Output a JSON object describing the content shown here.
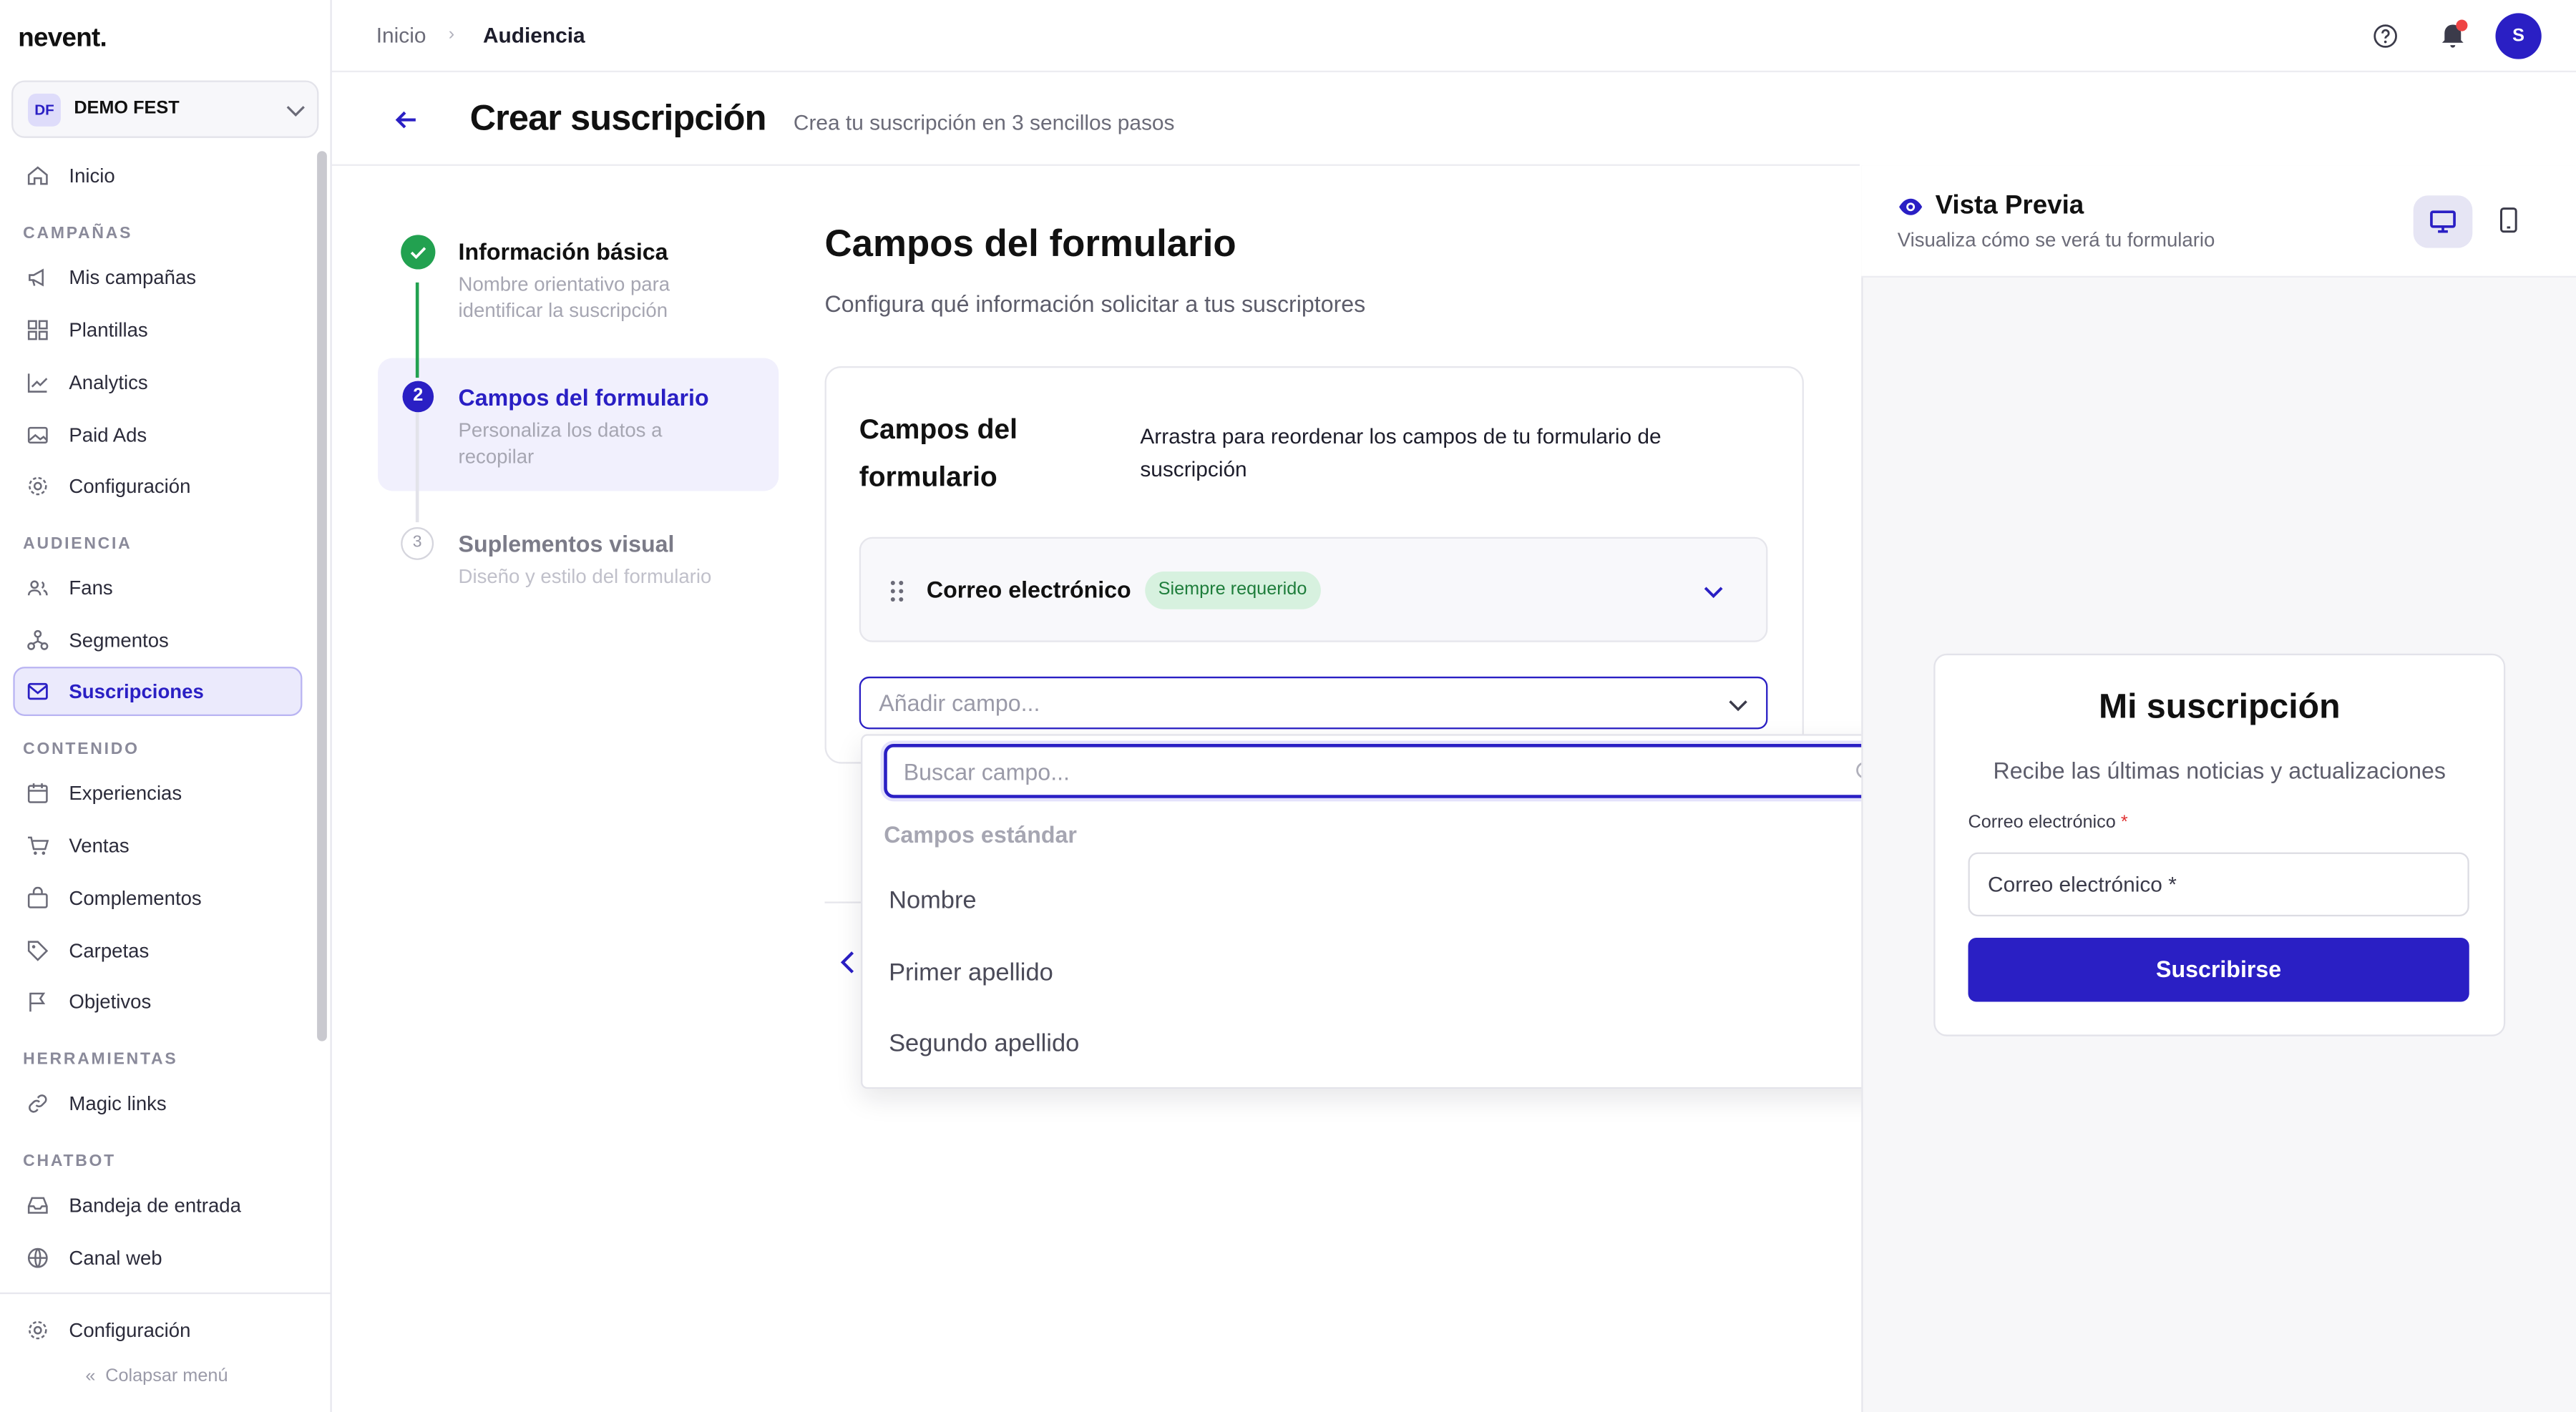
{
  "brand": {
    "logo": "nevent.",
    "org_initials": "DF",
    "org_name": "DEMO FEST",
    "accent": "#2a1fc4"
  },
  "sidebar": {
    "items": [
      {
        "label": "Inicio",
        "icon": "home-icon"
      },
      {
        "label": "Mis campañas",
        "icon": "megaphone-icon"
      },
      {
        "label": "Plantillas",
        "icon": "templates-icon"
      },
      {
        "label": "Analytics",
        "icon": "chart-icon"
      },
      {
        "label": "Paid Ads",
        "icon": "image-icon"
      },
      {
        "label": "Configuración",
        "icon": "gear-icon"
      },
      {
        "label": "Fans",
        "icon": "users-icon"
      },
      {
        "label": "Segmentos",
        "icon": "segments-icon"
      },
      {
        "label": "Suscripciones",
        "icon": "mail-icon",
        "active": true
      },
      {
        "label": "Experiencias",
        "icon": "calendar-icon"
      },
      {
        "label": "Ventas",
        "icon": "cart-icon"
      },
      {
        "label": "Complementos",
        "icon": "bag-icon"
      },
      {
        "label": "Carpetas",
        "icon": "tag-icon"
      },
      {
        "label": "Objetivos",
        "icon": "flag-icon"
      },
      {
        "label": "Magic links",
        "icon": "link-icon"
      },
      {
        "label": "Bandeja de entrada",
        "icon": "inbox-icon"
      },
      {
        "label": "Canal web",
        "icon": "globe-icon"
      },
      {
        "label": "Configuración",
        "icon": "gear-icon"
      }
    ],
    "sections": [
      "CAMPAÑAS",
      "AUDIENCIA",
      "CONTENIDO",
      "HERRAMIENTAS",
      "CHATBOT"
    ],
    "collapse_label": "Colapsar menú"
  },
  "topbar": {
    "crumb_home": "Inicio",
    "crumb_current": "Audiencia",
    "user_initial": "S"
  },
  "header": {
    "title": "Crear suscripción",
    "subtitle": "Crea tu suscripción en 3 sencillos pasos"
  },
  "steps": [
    {
      "title": "Información básica",
      "desc": "Nombre orientativo para identificar la suscripción",
      "state": "done"
    },
    {
      "number": "2",
      "title": "Campos del formulario",
      "desc": "Personaliza los datos a recopilar",
      "state": "active"
    },
    {
      "number": "3",
      "title": "Suplementos visual",
      "desc": "Diseño y estilo del formulario",
      "state": "pending"
    }
  ],
  "main": {
    "title": "Campos del formulario",
    "subtitle": "Configura qué información solicitar a tus suscriptores",
    "card_title": "Campos del formulario",
    "card_desc": "Arrastra para reordenar los campos de tu formulario de suscripción",
    "field_name": "Correo electrónico",
    "field_badge": "Siempre requerido",
    "add_placeholder": "Añadir campo..."
  },
  "dropdown": {
    "search_placeholder": "Buscar campo...",
    "group": "Campos estándar",
    "options": [
      "Nombre",
      "Primer apellido",
      "Segundo apellido"
    ]
  },
  "preview": {
    "title": "Vista Previa",
    "subtitle": "Visualiza cómo se verá tu formulario",
    "form_title": "Mi suscripción",
    "form_subtitle": "Recibe las últimas noticias y actualizaciones",
    "email_label": "Correo electrónico",
    "required_mark": "*",
    "email_placeholder": "Correo electrónico *",
    "submit": "Suscribirse"
  }
}
